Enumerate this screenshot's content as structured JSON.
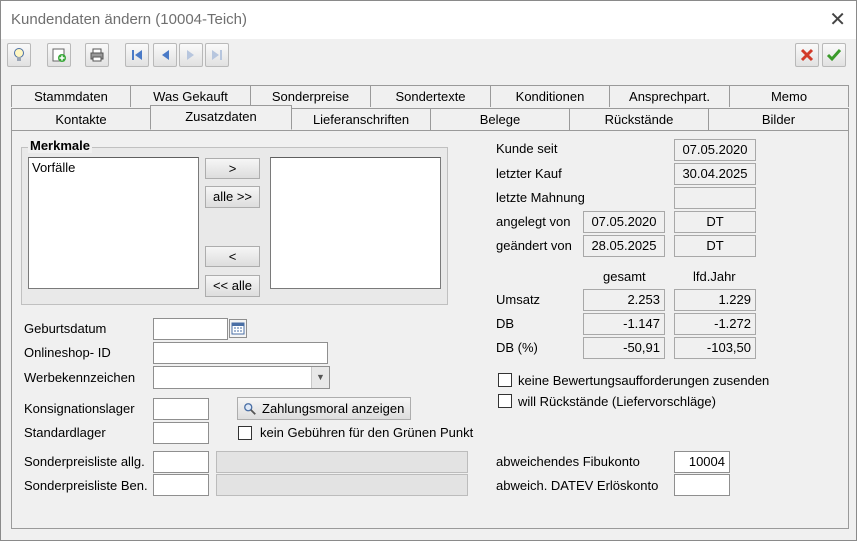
{
  "window": {
    "title": "Kundendaten ändern (10004-Teich)"
  },
  "tabs_row1": [
    "Stammdaten",
    "Was Gekauft",
    "Sonderpreise",
    "Sondertexte",
    "Konditionen",
    "Ansprechpart.",
    "Memo"
  ],
  "tabs_row2": [
    "Kontakte",
    "Zusatzdaten",
    "Lieferanschriften",
    "Belege",
    "Rückstände",
    "Bilder"
  ],
  "merkmale": {
    "legend": "Merkmale",
    "left_items": [
      "Vorfälle"
    ],
    "btn_add": ">",
    "btn_add_all": "alle >>",
    "btn_remove": "<",
    "btn_remove_all": "<< alle"
  },
  "form": {
    "geburtsdatum_label": "Geburtsdatum",
    "geburtsdatum_value": "",
    "onlineshop_label": "Onlineshop- ID",
    "onlineshop_value": "",
    "werbekennzeichen_label": "Werbekennzeichen",
    "werbekennzeichen_value": "",
    "konsignationslager_label": "Konsignationslager",
    "konsignationslager_value": "",
    "standardlager_label": "Standardlager",
    "standardlager_value": "",
    "zahlungsmoral_button": "Zahlungsmoral anzeigen",
    "gruener_punkt_label": "kein Gebühren für den Grünen Punkt",
    "sonderpreisliste_allg_label": "Sonderpreisliste allg.",
    "sonderpreisliste_ben_label": "Sonderpreisliste Ben."
  },
  "info": {
    "kunde_seit_label": "Kunde seit",
    "kunde_seit_value": "07.05.2020",
    "letzter_kauf_label": "letzter Kauf",
    "letzter_kauf_value": "30.04.2025",
    "letzte_mahnung_label": "letzte Mahnung",
    "letzte_mahnung_value": "",
    "angelegt_label": "angelegt von",
    "angelegt_date": "07.05.2020",
    "angelegt_user": "DT",
    "geaendert_label": "geändert von",
    "geaendert_date": "28.05.2025",
    "geaendert_user": "DT",
    "col_gesamt": "gesamt",
    "col_lfd_jahr": "lfd.Jahr",
    "umsatz_label": "Umsatz",
    "umsatz_gesamt": "2.253",
    "umsatz_jahr": "1.229",
    "db_label": "DB",
    "db_gesamt": "-1.147",
    "db_jahr": "-1.272",
    "dbp_label": "DB (%)",
    "dbp_gesamt": "-50,91",
    "dbp_jahr": "-103,50",
    "keine_bewertung_label": "keine Bewertungsaufforderungen zusenden",
    "rueckstaende_label": "will Rückstände (Liefervorschläge)",
    "fibukonto_label": "abweichendes Fibukonto",
    "fibukonto_value": "10004",
    "datev_label": "abweich. DATEV Erlöskonto",
    "datev_value": ""
  }
}
